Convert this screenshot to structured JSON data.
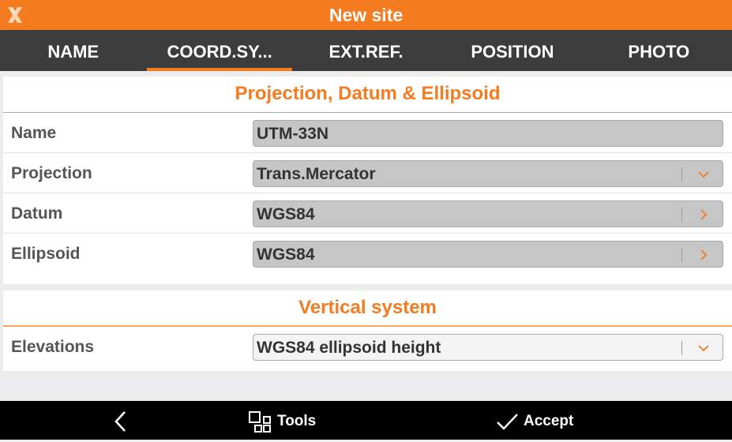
{
  "header": {
    "title": "New site"
  },
  "tabs": [
    {
      "label": "NAME",
      "active": false
    },
    {
      "label": "COORD.SY...",
      "active": true
    },
    {
      "label": "EXT.REF.",
      "active": false
    },
    {
      "label": "POSITION",
      "active": false
    },
    {
      "label": "PHOTO",
      "active": false
    }
  ],
  "projection_section": {
    "heading": "Projection, Datum & Ellipsoid",
    "rows": [
      {
        "label": "Name",
        "value": "UTM-33N"
      },
      {
        "label": "Projection",
        "value": "Trans.Mercator",
        "icon": "chevron-down-icon"
      },
      {
        "label": "Datum",
        "value": "WGS84",
        "icon": "chevron-right-icon"
      },
      {
        "label": "Ellipsoid",
        "value": "WGS84",
        "icon": "chevron-right-icon"
      }
    ]
  },
  "vertical_section": {
    "heading": "Vertical system",
    "rows": [
      {
        "label": "Elevations",
        "value": "WGS84 ellipsoid height",
        "icon": "chevron-down-icon"
      }
    ]
  },
  "bottom_bar": {
    "back_icon": "back-arrow-icon",
    "tools_label": "Tools",
    "tools_icon": "tools-grid-icon",
    "accept_label": "Accept",
    "accept_icon": "checkmark-icon"
  },
  "colors": {
    "accent": "#f47b20",
    "tab_bar": "#3c3c3c",
    "bottom_bar": "#000000",
    "field_bg": "#c6c6c6"
  }
}
